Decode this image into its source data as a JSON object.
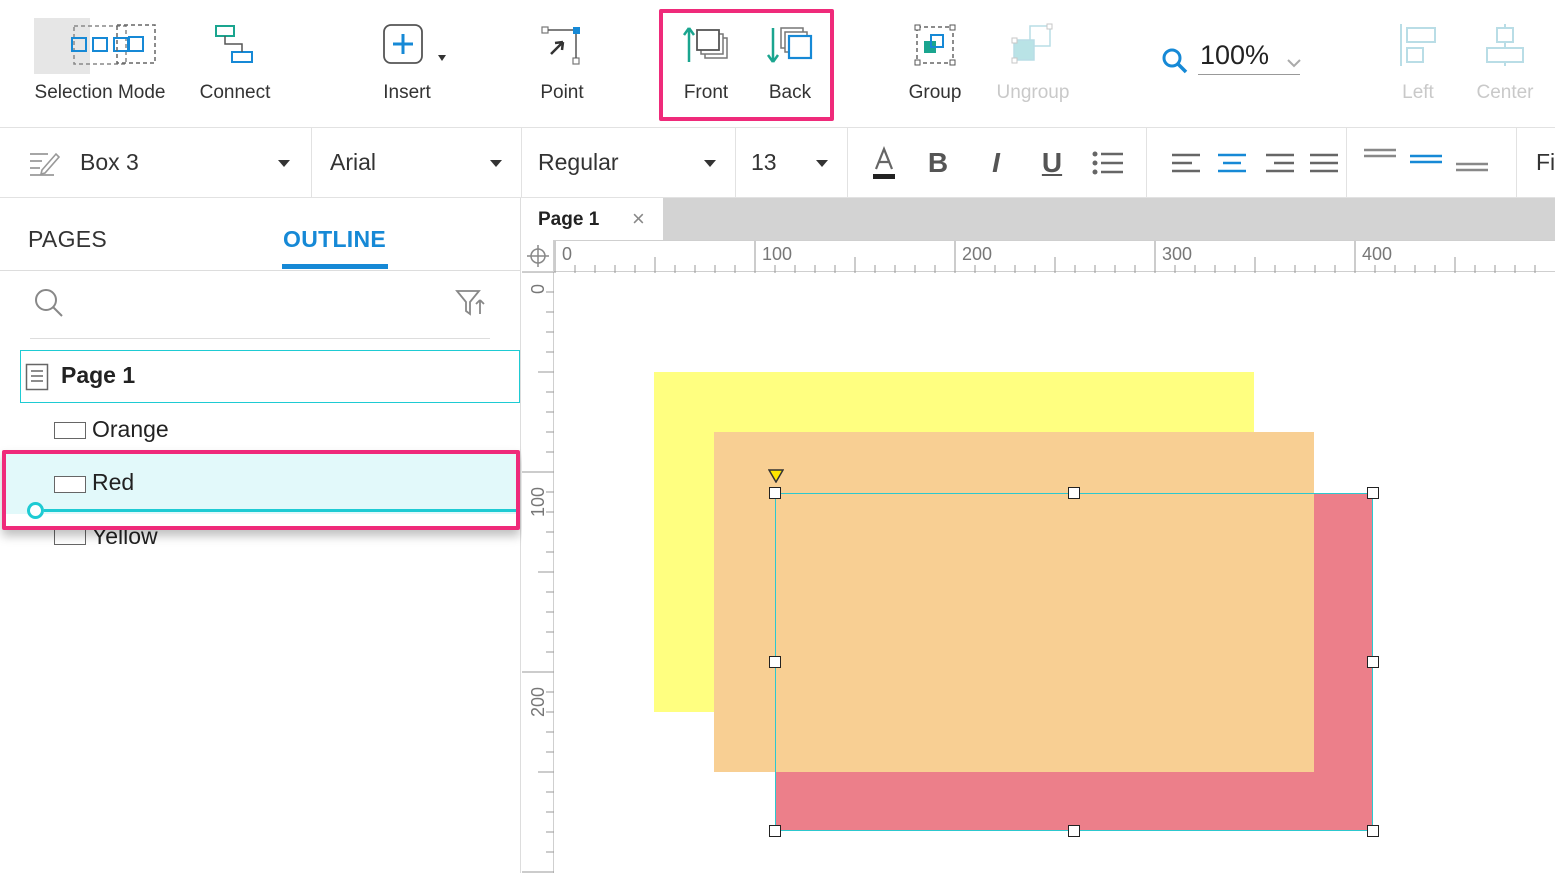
{
  "toolbar": {
    "selection_mode_label": "Selection Mode",
    "connect_label": "Connect",
    "insert_label": "Insert",
    "point_label": "Point",
    "front_label": "Front",
    "back_label": "Back",
    "group_label": "Group",
    "ungroup_label": "Ungroup",
    "zoom_value": "100%",
    "left_label": "Left",
    "center_label": "Center"
  },
  "formatbar": {
    "shape_name": "Box 3",
    "font_family": "Arial",
    "font_weight": "Regular",
    "font_size": "13",
    "fill_label_partial": "Fi",
    "bold_glyph": "B",
    "italic_glyph": "I",
    "underline_glyph": "U"
  },
  "panel": {
    "tabs": [
      "PAGES",
      "OUTLINE"
    ],
    "active_tab": "OUTLINE"
  },
  "outline": {
    "page": "Page 1",
    "items": [
      "Orange",
      "Red",
      "Yellow"
    ],
    "selected": "Red"
  },
  "canvas": {
    "tab_title": "Page 1",
    "close_glyph": "×",
    "hruler": [
      "0",
      "100",
      "200",
      "300",
      "400"
    ],
    "vruler": [
      "0",
      "100",
      "200"
    ]
  },
  "colors": {
    "accent": "#1689d6",
    "highlight": "#ef2a7a",
    "selection": "#1ecbd3",
    "yellow_box": "#ffff80",
    "orange_box": "#f8cf93",
    "red_box": "#ec7f8a"
  },
  "icons": {
    "selection_mode": "selection-mode-icon",
    "connect": "connect-icon",
    "insert": "plus-square-icon",
    "point": "point-icon",
    "front": "bring-to-front-icon",
    "back": "send-to-back-icon",
    "group": "group-icon",
    "ungroup": "ungroup-icon",
    "zoom": "search-icon",
    "search": "search-icon",
    "filter": "filter-icon"
  }
}
